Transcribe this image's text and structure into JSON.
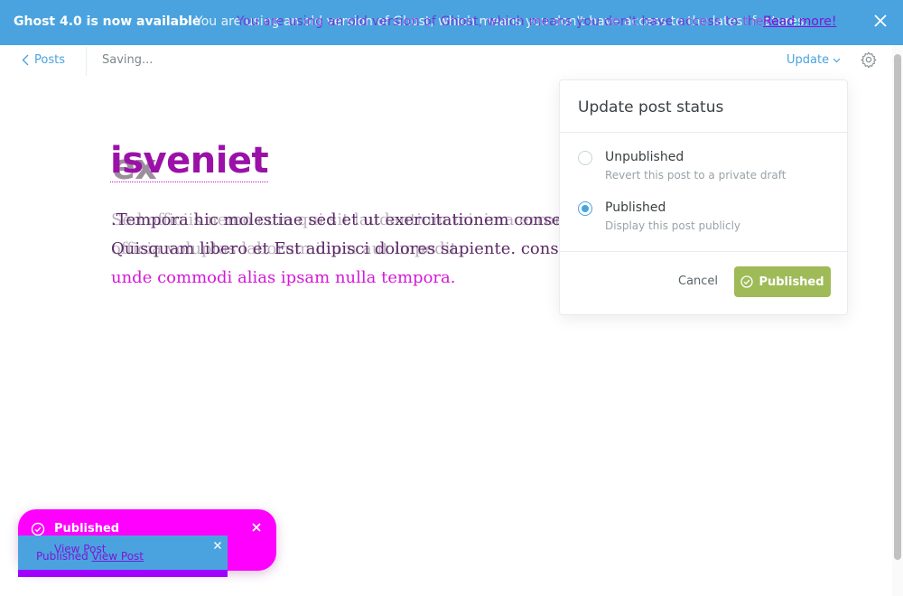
{
  "banner": {
    "title": "Ghost 4.0 is now available",
    "dash": "-",
    "message": "You are using an old version of Ghost, which means you don't have access to the latest features.",
    "ghost_message": "You are using an old version of Ghost, which means you don't have access to the latest features.",
    "link": "Read more!",
    "close_icon": "close-icon",
    "color": "#4aa3df"
  },
  "header": {
    "back_label": "Posts",
    "status": "Saving...",
    "update_label": "Update",
    "gear_icon": "gear-icon"
  },
  "editor": {
    "title_overlay": "iste",
    "title_main": "isveniet",
    "title_under": "ex",
    "lines": [
      ".Tempora hic molestiae sed et ut exercitationem consequ",
      "Quisquam libero et Est adipisci dolores sapiente. consequ",
      "unde commodi alias ipsam nulla tempora."
    ],
    "ghost_lines": [
      "Sed officiis nemo cum qui sit laudantium minima error",
      "officia voluptas laborum illum aut impedit."
    ]
  },
  "popover": {
    "title": "Update post status",
    "options": [
      {
        "label": "Unpublished",
        "desc": "Revert this post to a private draft",
        "selected": false
      },
      {
        "label": "Published",
        "desc": "Display this post publicly",
        "selected": true
      }
    ],
    "cancel_label": "Cancel",
    "confirm_label": "Published",
    "confirm_color": "#9fbb58"
  },
  "toast": {
    "title": "Published",
    "view_label": "View Post",
    "row2_prefix": "Published",
    "row2_link": "View Post",
    "color": "#ff00ff"
  }
}
